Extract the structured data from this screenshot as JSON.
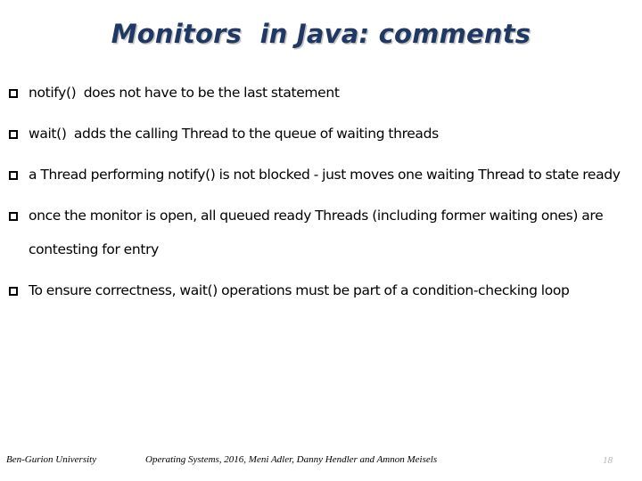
{
  "slide": {
    "title": "Monitors  in Java: comments",
    "title_color": "#1F3864",
    "background_color": "#FFFFFF",
    "bullet_glyph": "square-outline",
    "bullets": [
      {
        "marker": "❑",
        "text": "notify()  does not have to be the last statement"
      },
      {
        "marker": "❑",
        "text": "wait()  adds the calling Thread to the queue of waiting threads"
      },
      {
        "marker": "❑",
        "text": "a Thread performing notify() is not blocked - just moves one waiting Thread to state ready"
      },
      {
        "marker": "❑",
        "text": "once the monitor is open, all queued ready Threads (including former waiting ones) are contesting for entry"
      },
      {
        "marker": "❑",
        "text": "To ensure correctness, wait() operations must be part of a condition-checking loop"
      }
    ]
  },
  "footer": {
    "left": "Ben-Gurion University",
    "center": "Operating Systems, 2016, Meni Adler, Danny Hendler and Amnon Meisels",
    "page_number": "18",
    "page_number_color": "#B6B6B6"
  }
}
